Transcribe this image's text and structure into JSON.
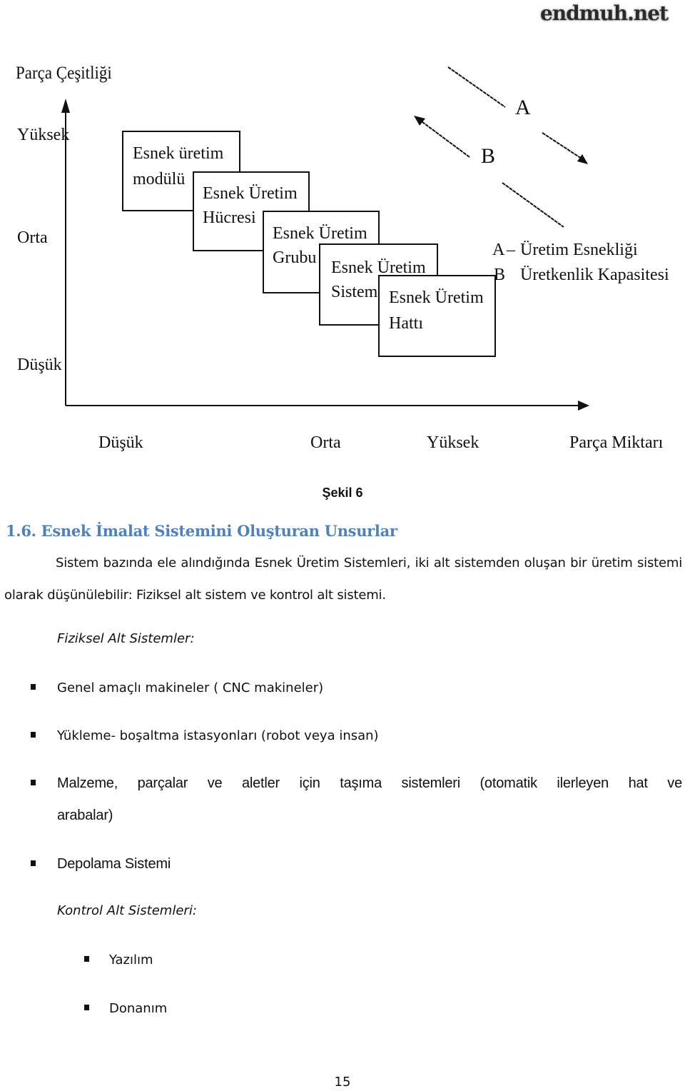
{
  "watermark": {
    "text": "endmuh.net"
  },
  "figure": {
    "y_axis_title": "Parça Çeşitliği",
    "y_ticks": [
      "Yüksek",
      "Orta",
      "Düşük"
    ],
    "x_ticks": [
      "Düşük",
      "Orta",
      "Yüksek"
    ],
    "x_axis_title": "Parça Miktarı",
    "boxes": [
      {
        "line1": "Esnek üretim",
        "line2": "modülü"
      },
      {
        "line1": "Esnek Üretim",
        "line2": "Hücresi"
      },
      {
        "line1": "Esnek Üretim",
        "line2": "Grubu"
      },
      {
        "line1": "Esnek Üretim",
        "line2": "Sistemi"
      },
      {
        "line1": "Esnek Üretim",
        "line2": "Hattı"
      }
    ],
    "arrow_labels": {
      "a": "A",
      "b": "B"
    },
    "legend": [
      {
        "key": "A",
        "sep": "–",
        "label": "Üretim Esnekliği"
      },
      {
        "key": "B",
        "sep": "",
        "label": "Üretkenlik Kapasitesi"
      }
    ],
    "caption": "Şekil 6"
  },
  "section": {
    "heading": "1.6. Esnek İmalat Sistemini Oluşturan Unsurlar",
    "paragraph": "Sistem bazında ele alındığında Esnek Üretim Sistemleri, iki alt sistemden oluşan bir üretim sistemi olarak düşünülebilir: Fiziksel alt sistem ve kontrol alt sistemi.",
    "physical": {
      "title": "Fiziksel Alt Sistemler:",
      "items": [
        "Genel amaçlı makineler ( CNC makineler)",
        "Yükleme- boşaltma istasyonları (robot veya insan)",
        "Malzeme, parçalar ve aletler için taşıma sistemleri (otomatik ilerleyen hat ve",
        "arabalar)",
        "Depolama Sistemi"
      ]
    },
    "control": {
      "title": "Kontrol Alt Sistemleri:",
      "items": [
        "Yazılım",
        "Donanım"
      ]
    }
  },
  "page_number": "15"
}
